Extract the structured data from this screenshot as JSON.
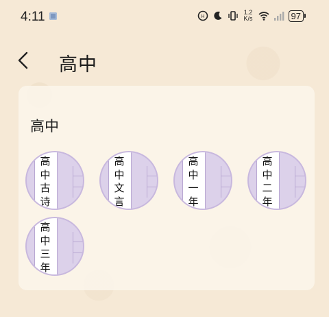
{
  "status_bar": {
    "time": "4:11",
    "network_speed_value": "1.2",
    "network_speed_unit": "K/s",
    "battery": "97"
  },
  "header": {
    "back_icon": "chevron-left-icon",
    "title": "高中"
  },
  "section": {
    "title": "高中",
    "books": [
      {
        "label": "高中古诗"
      },
      {
        "label": "高中文言"
      },
      {
        "label": "高中一年"
      },
      {
        "label": "高中二年"
      },
      {
        "label": "高中三年"
      }
    ]
  },
  "colors": {
    "background": "#f6e9d6",
    "card": "#fbf4e9",
    "book_circle": "#dcd1ea",
    "book_border": "#c8b8de"
  }
}
